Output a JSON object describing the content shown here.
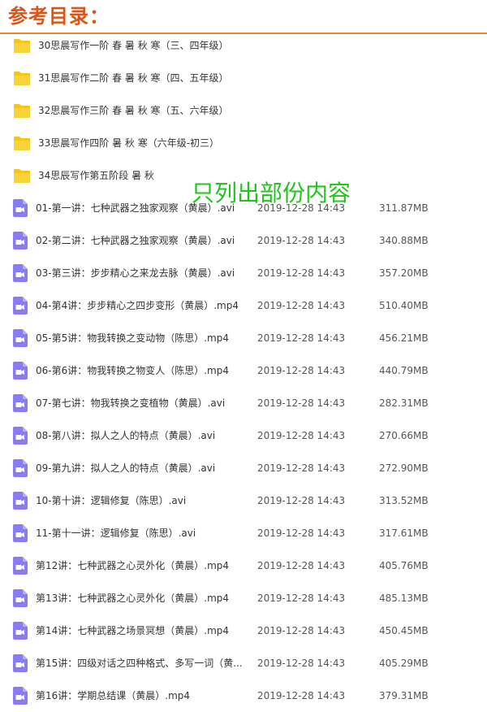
{
  "header": {
    "title": "参考目录："
  },
  "overlay_text": "只列出部份内容",
  "colors": {
    "title": "#d8561a",
    "rule": "#e6882e",
    "folder": "#f5c518",
    "video_icon": "#8a7cf0",
    "overlay": "#22c41e"
  },
  "folders": [
    {
      "name": "30思晨写作一阶 春 暑 秋 寒（三、四年级）",
      "icon": "folder-icon"
    },
    {
      "name": "31思晨写作二阶 春 暑 秋 寒（四、五年级）",
      "icon": "folder-icon"
    },
    {
      "name": "32思晨写作三阶 春 暑 秋 寒（五、六年级）",
      "icon": "folder-icon"
    },
    {
      "name": "33思晨写作四阶 暑 秋 寒（六年级-初三）",
      "icon": "folder-icon"
    },
    {
      "name": "34思辰写作第五阶段 暑 秋",
      "icon": "folder-icon"
    }
  ],
  "files": [
    {
      "name": "01-第一讲：七种武器之独家观察（黄晨）.avi",
      "date": "2019-12-28 14:43",
      "size": "311.87MB",
      "icon": "video-file-icon"
    },
    {
      "name": "02-第二讲：七种武器之独家观察（黄晨）.avi",
      "date": "2019-12-28 14:43",
      "size": "340.88MB",
      "icon": "video-file-icon"
    },
    {
      "name": "03-第三讲：步步精心之来龙去脉（黄晨）.avi",
      "date": "2019-12-28 14:43",
      "size": "357.20MB",
      "icon": "video-file-icon"
    },
    {
      "name": "04-第4讲：步步精心之四步变形（黄晨）.mp4",
      "date": "2019-12-28 14:43",
      "size": "510.40MB",
      "icon": "video-file-icon"
    },
    {
      "name": "05-第5讲：物我转换之变动物（陈思）.mp4",
      "date": "2019-12-28 14:43",
      "size": "456.21MB",
      "icon": "video-file-icon"
    },
    {
      "name": "06-第6讲：物我转换之物变人（陈思）.mp4",
      "date": "2019-12-28 14:43",
      "size": "440.79MB",
      "icon": "video-file-icon"
    },
    {
      "name": "07-第七讲：物我转换之变植物（黄晨）.avi",
      "date": "2019-12-28 14:43",
      "size": "282.31MB",
      "icon": "video-file-icon"
    },
    {
      "name": "08-第八讲：拟人之人的特点（黄晨）.avi",
      "date": "2019-12-28 14:43",
      "size": "270.66MB",
      "icon": "video-file-icon"
    },
    {
      "name": "09-第九讲：拟人之人的特点（黄晨）.avi",
      "date": "2019-12-28 14:43",
      "size": "272.90MB",
      "icon": "video-file-icon"
    },
    {
      "name": "10-第十讲：逻辑修复（陈思）.avi",
      "date": "2019-12-28 14:43",
      "size": "313.52MB",
      "icon": "video-file-icon"
    },
    {
      "name": "11-第十一讲：逻辑修复（陈思）.avi",
      "date": "2019-12-28 14:43",
      "size": "317.61MB",
      "icon": "video-file-icon"
    },
    {
      "name": "第12讲：七种武器之心灵外化（黄晨）.mp4",
      "date": "2019-12-28 14:43",
      "size": "405.76MB",
      "icon": "video-file-icon"
    },
    {
      "name": "第13讲：七种武器之心灵外化（黄晨）.mp4",
      "date": "2019-12-28 14:43",
      "size": "485.13MB",
      "icon": "video-file-icon"
    },
    {
      "name": "第14讲：七种武器之场景冥想（黄晨）.mp4",
      "date": "2019-12-28 14:43",
      "size": "450.45MB",
      "icon": "video-file-icon"
    },
    {
      "name": "第15讲：四级对话之四种格式、多写一词（黄...",
      "date": "2019-12-28 14:43",
      "size": "405.29MB",
      "icon": "video-file-icon"
    },
    {
      "name": "第16讲：学期总结课（黄晨）.mp4",
      "date": "2019-12-28 14:43",
      "size": "379.31MB",
      "icon": "video-file-icon"
    }
  ]
}
